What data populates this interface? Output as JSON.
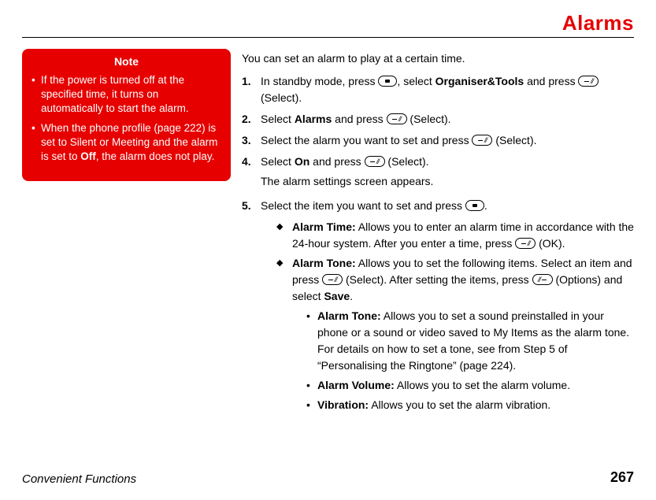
{
  "header": {
    "title": "Alarms"
  },
  "note": {
    "header": "Note",
    "items": [
      {
        "text": "If the power is turned off at the specified time, it turns on automatically to start the alarm."
      },
      {
        "prefix": "When the phone profile (page 222) is set to Silent or Meeting and the alarm is set to ",
        "bold": "Off",
        "suffix": ", the alarm does not play."
      }
    ]
  },
  "main": {
    "intro": "You can set an alarm to play at a certain time.",
    "steps": {
      "s1": {
        "t1": "In standby mode, press ",
        "t2": ", select ",
        "b1": "Organiser&Tools",
        "t3": " and press ",
        "t4": " (Select)."
      },
      "s2": {
        "t1": "Select ",
        "b1": "Alarms",
        "t2": " and press ",
        "t3": " (Select)."
      },
      "s3": {
        "t1": "Select the alarm you want to set and press ",
        "t2": " (Select)."
      },
      "s4": {
        "t1": "Select ",
        "b1": "On",
        "t2": " and press ",
        "t3": " (Select).",
        "sub": "The alarm settings screen appears."
      },
      "s5": {
        "t1": "Select the item you want to set and press ",
        "t2": "."
      }
    },
    "diamonds": {
      "d1": {
        "label": "Alarm Time:",
        "t1": " Allows you to enter an alarm time in accordance with the 24-hour system. After you enter a time, press ",
        "t2": " (OK)."
      },
      "d2": {
        "label": "Alarm Tone:",
        "t1": " Allows you to set the following items. Select an item and press ",
        "t2": " (Select). After setting the items, press ",
        "t3": " (Options) and select ",
        "b1": "Save",
        "t4": "."
      }
    },
    "bullets": {
      "b1": {
        "label": "Alarm Tone:",
        "text": " Allows you to set a sound preinstalled in your phone or a sound or video saved to My Items as the alarm tone. For details on how to set a tone, see from Step 5 of “Personalising the Ringtone” (page 224)."
      },
      "b2": {
        "label": "Alarm Volume:",
        "text": " Allows you to set the alarm volume."
      },
      "b3": {
        "label": "Vibration:",
        "text": " Allows you to set the alarm vibration."
      }
    }
  },
  "footer": {
    "section": "Convenient Functions",
    "page": "267"
  }
}
